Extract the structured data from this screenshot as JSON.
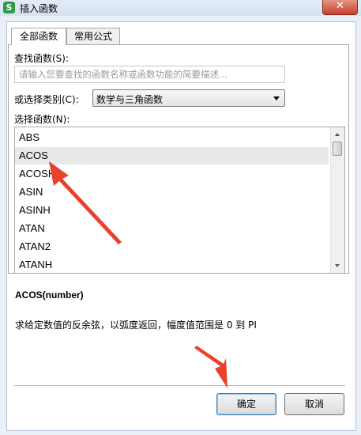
{
  "window": {
    "app_icon_glyph": "S",
    "title": "插入函数",
    "close_glyph": "✕"
  },
  "tabs": [
    {
      "label": "全部函数",
      "active": true
    },
    {
      "label": "常用公式",
      "active": false
    }
  ],
  "search": {
    "label": "查找函数(S):",
    "value": "",
    "placeholder": "请输入您要查找的函数名称或函数功能的简要描述..."
  },
  "category": {
    "label": "或选择类别(C):",
    "selected": "数学与三角函数"
  },
  "function_list": {
    "label": "选择函数(N):",
    "items": [
      "ABS",
      "ACOS",
      "ACOSH",
      "ASIN",
      "ASINH",
      "ATAN",
      "ATAN2",
      "ATANH"
    ],
    "selected_index": 1
  },
  "details": {
    "signature": "ACOS(number)",
    "description": "求给定数值的反余弦，以弧度返回，幅度值范围是 0 到 PI"
  },
  "buttons": {
    "ok": "确定",
    "cancel": "取消"
  },
  "colors": {
    "annotation_arrow": "#e8412c",
    "selected_row": "#e9e9e9"
  }
}
